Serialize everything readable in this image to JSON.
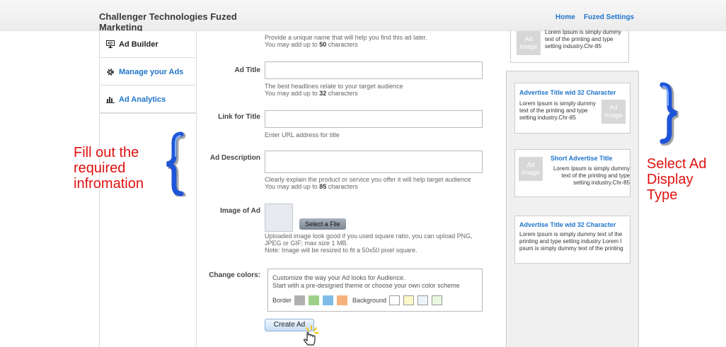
{
  "header": {
    "brand": "Challenger Technologies Fuzed Marketing",
    "nav": {
      "home": "Home",
      "settings": "Fuzed Settings"
    }
  },
  "sidebar": {
    "items": [
      {
        "label": "Ad Builder",
        "icon": "monitor-ad-icon"
      },
      {
        "label": "Manage your Ads",
        "icon": "gear-icon"
      },
      {
        "label": "Ad Analytics",
        "icon": "bar-chart-icon"
      }
    ]
  },
  "form": {
    "ad_name": {
      "hint_line1": "Provide a unique name that will help you find this ad later.",
      "hint_prefix": "You may add up to ",
      "hint_count": "50",
      "hint_suffix": " characters"
    },
    "ad_title": {
      "label": "Ad Title",
      "value": "",
      "hint_line1": "The best headlines relate to your target audience",
      "hint_prefix": "You may add up to ",
      "hint_count": "32",
      "hint_suffix": " characters"
    },
    "link": {
      "label": "Link for Title",
      "value": "",
      "hint": "Enter URL address for title"
    },
    "description": {
      "label": "Ad Description",
      "value": "",
      "hint_line1": "Clearly explain the product or service you offer it will help target audience",
      "hint_prefix": "You may add up to ",
      "hint_count": "85",
      "hint_suffix": " characters"
    },
    "image": {
      "label": "Image of Ad",
      "button": "Select a File",
      "hint_line1": "Uploaded image look good if you used square ratio, you can upload PNG,",
      "hint_line2": "JPEG or GIF; max size 1 MB.",
      "hint_line3": "Note: Image will be resized to fit a 50x50 pixel square."
    },
    "colors": {
      "label": "Change colors:",
      "line1": "Customize the way your Ad looks for Audience.",
      "line2": "Start with a pre-designed theme or choose your own color scheme",
      "border_label": "Border",
      "background_label": "Background",
      "border_swatches": [
        "#b0b0b0",
        "#9fd08a",
        "#7fbde8",
        "#f5b27a"
      ],
      "background_swatches": [
        "#ffffff",
        "#fdf8c8",
        "#eaf4fc",
        "#eaf8e2"
      ]
    },
    "submit": "Create Ad"
  },
  "ads": {
    "image_text_line1": "Ad",
    "image_text_line2": "Image",
    "top": {
      "body": "Lorem Ipsum is simply dummy text of the printing and type setting industry.Chr-85"
    },
    "card1": {
      "title": "Advertise Title wid 32 Character",
      "body": "Lorem Ipsum is simply dummy text of the printing and type setting industry.Chr-85"
    },
    "card2": {
      "title": "Short Advertise Title",
      "body": "Lorem Ipsum is simply dummy text of the printing and type setting industry.Chr-85"
    },
    "card3": {
      "title": "Advertise Title wid 32 Character",
      "body": "Lorem Ipsum is simply dummy text of the printing and type setting industry Lorem I psum is simply dummy text of the printing"
    }
  },
  "annotations": {
    "left_line1": "Fill out the",
    "left_line2": "required",
    "left_line3": "infromation",
    "right_line1": "Select Ad",
    "right_line2": "Display",
    "right_line3": "Type"
  },
  "colors": {
    "link": "#1f74c9",
    "annotation": "#e01010",
    "brace": "#1e55d8"
  }
}
